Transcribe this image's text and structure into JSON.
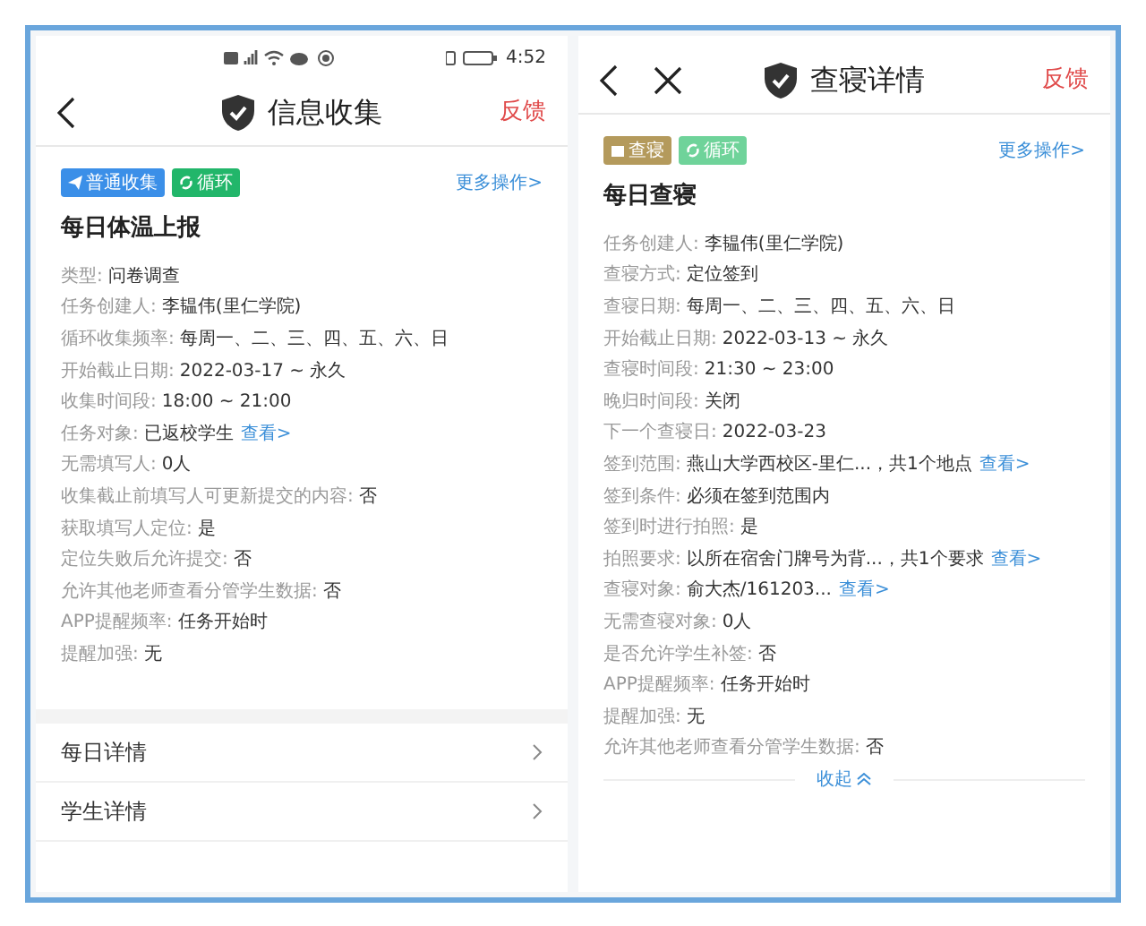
{
  "panels": [
    {
      "status_bar": {
        "time": "4:52"
      },
      "header": {
        "title": "信息收集",
        "feedback": "反馈",
        "close": false
      },
      "tags": [
        {
          "label": "普通收集",
          "kind": "send",
          "color": "#3b8fe8"
        },
        {
          "label": "循环",
          "kind": "loop",
          "color": "#22b66a"
        }
      ],
      "more": "更多操作>",
      "title": "每日体温上报",
      "fields": [
        {
          "label": "类型:",
          "value": "问卷调查"
        },
        {
          "label": "任务创建人:",
          "value": "李韫伟(里仁学院)"
        },
        {
          "label": "循环收集频率:",
          "value": "每周一、二、三、四、五、六、日"
        },
        {
          "label": "开始截止日期:",
          "value": "2022-03-17 ~ 永久"
        },
        {
          "label": "收集时间段:",
          "value": "18:00 ~ 21:00"
        },
        {
          "label": "任务对象:",
          "value": "已返校学生",
          "link": "查看>"
        },
        {
          "label": "无需填写人:",
          "value": "0人"
        },
        {
          "label": "收集截止前填写人可更新提交的内容:",
          "value": "否"
        },
        {
          "label": "获取填写人定位:",
          "value": "是"
        },
        {
          "label": "定位失败后允许提交:",
          "value": "否"
        },
        {
          "label": "允许其他老师查看分管学生数据:",
          "value": "否"
        },
        {
          "label": "APP提醒频率:",
          "value": "任务开始时"
        },
        {
          "label": "提醒加强:",
          "value": "无"
        }
      ],
      "links": [
        "每日详情",
        "学生详情"
      ]
    },
    {
      "header": {
        "title": "查寝详情",
        "feedback": "反馈",
        "close": true
      },
      "tags": [
        {
          "label": "查寝",
          "kind": "bed",
          "color": "#b49a5c"
        },
        {
          "label": "循环",
          "kind": "loop",
          "color": "#6fd39a"
        }
      ],
      "more": "更多操作>",
      "title": "每日查寝",
      "fields": [
        {
          "label": "任务创建人:",
          "value": "李韫伟(里仁学院)"
        },
        {
          "label": "查寝方式:",
          "value": "定位签到"
        },
        {
          "label": "查寝日期:",
          "value": "每周一、二、三、四、五、六、日"
        },
        {
          "label": "开始截止日期:",
          "value": "2022-03-13 ~ 永久"
        },
        {
          "label": "查寝时间段:",
          "value": "21:30 ~ 23:00"
        },
        {
          "label": "晚归时间段:",
          "value": "关闭"
        },
        {
          "label": "下一个查寝日:",
          "value": "2022-03-23"
        },
        {
          "label": "签到范围:",
          "value": "燕山大学西校区-里仁...，共1个地点",
          "link": "查看>"
        },
        {
          "label": "签到条件:",
          "value": "必须在签到范围内"
        },
        {
          "label": "签到时进行拍照:",
          "value": "是"
        },
        {
          "label": "拍照要求:",
          "value": "以所在宿舍门牌号为背...，共1个要求",
          "link": "查看>"
        },
        {
          "label": "查寝对象:",
          "value": "俞大杰/161203...",
          "link": "查看>"
        },
        {
          "label": "无需查寝对象:",
          "value": "0人"
        },
        {
          "label": "是否允许学生补签:",
          "value": "否"
        },
        {
          "label": "APP提醒频率:",
          "value": "任务开始时"
        },
        {
          "label": "提醒加强:",
          "value": "无"
        },
        {
          "label": "允许其他老师查看分管学生数据:",
          "value": "否"
        }
      ],
      "collapse": "收起"
    }
  ]
}
